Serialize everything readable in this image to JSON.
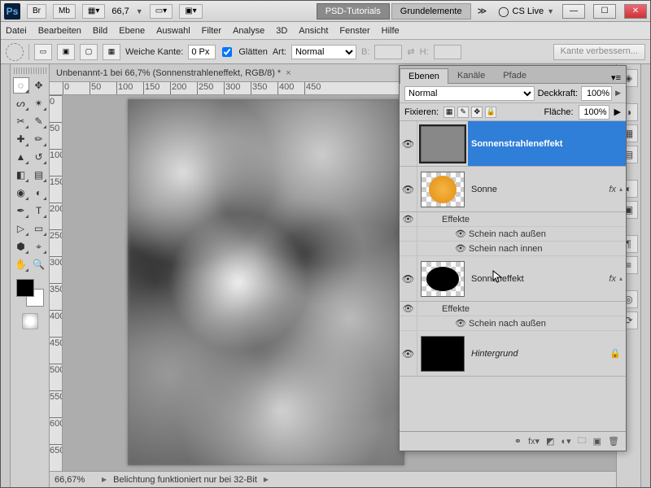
{
  "titlebar": {
    "ps": "Ps",
    "br": "Br",
    "mb": "Mb",
    "zoom": "66,7",
    "workspaceActive": "PSD-Tutorials",
    "workspace2": "Grundelemente",
    "cslive": "CS Live"
  },
  "menubar": [
    "Datei",
    "Bearbeiten",
    "Bild",
    "Ebene",
    "Auswahl",
    "Filter",
    "Analyse",
    "3D",
    "Ansicht",
    "Fenster",
    "Hilfe"
  ],
  "optbar": {
    "weicheKante": "Weiche Kante:",
    "weicheVal": "0 Px",
    "glatten": "Glätten",
    "art": "Art:",
    "artVal": "Normal",
    "b": "B:",
    "h": "H:",
    "btn": "Kante verbessern..."
  },
  "doc": {
    "tab": "Unbenannt-1 bei 66,7% (Sonnenstrahleneffekt, RGB/8) *",
    "ruler_h": [
      "0",
      "50",
      "100",
      "150",
      "200",
      "250",
      "300",
      "350",
      "400",
      "450"
    ],
    "ruler_v": [
      "0",
      "50",
      "100",
      "150",
      "200",
      "250",
      "300",
      "350",
      "400",
      "450",
      "500",
      "550",
      "600",
      "650"
    ]
  },
  "status": {
    "pct": "66,67%",
    "note": "Belichtung funktioniert nur bei 32-Bit"
  },
  "layers": {
    "tabs": [
      "Ebenen",
      "Kanäle",
      "Pfade"
    ],
    "blend": "Normal",
    "opacityLabel": "Deckkraft:",
    "opacity": "100%",
    "lockLabel": "Fixieren:",
    "fillLabel": "Fläche:",
    "fill": "100%",
    "items": [
      {
        "name": "Sonnenstrahleneffekt"
      },
      {
        "name": "Sonne"
      },
      {
        "name": "Sonneneffekt"
      },
      {
        "name": "Hintergrund"
      }
    ],
    "effekte": "Effekte",
    "outerGlow": "Schein nach außen",
    "innerGlow": "Schein nach innen",
    "fx": "fx"
  }
}
